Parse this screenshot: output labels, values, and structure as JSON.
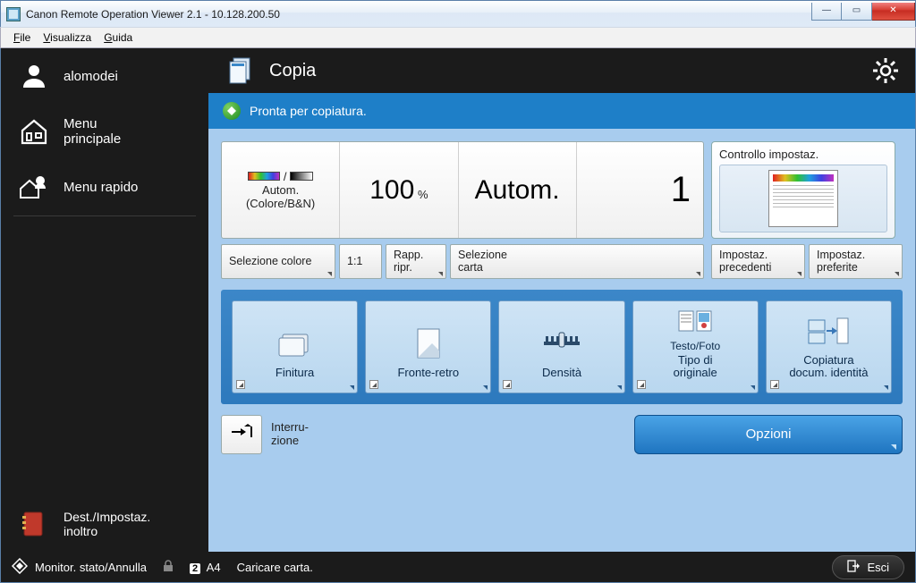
{
  "window": {
    "title": "Canon Remote Operation Viewer 2.1 - 10.128.200.50"
  },
  "menubar": {
    "file": "File",
    "view": "Visualizza",
    "help": "Guida"
  },
  "sidebar": {
    "user": "alomodei",
    "home_l1": "Menu",
    "home_l2": "principale",
    "quick": "Menu rapido",
    "forward_l1": "Dest./Impostaz.",
    "forward_l2": "inoltro"
  },
  "header": {
    "title": "Copia"
  },
  "status": {
    "text": "Pronta per copiatura."
  },
  "summary": {
    "color_l1": "Autom.",
    "color_l2": "(Colore/B&N)",
    "ratio_value": "100",
    "ratio_unit": "%",
    "paper": "Autom.",
    "copies": "1"
  },
  "controllo": {
    "label": "Controllo impostaz."
  },
  "buttons_row": {
    "select_color": "Selezione colore",
    "one_to_one": "1:1",
    "ratio_l1": "Rapp.",
    "ratio_l2": "ripr.",
    "paper_l1": "Selezione",
    "paper_l2": "carta",
    "prev_l1": "Impostaz.",
    "prev_l2": "precedenti",
    "fav_l1": "Impostaz.",
    "fav_l2": "preferite"
  },
  "tiles": {
    "finish": "Finitura",
    "duplex": "Fronte-retro",
    "density": "Densità",
    "orig_caption": "Testo/Foto",
    "orig_l1": "Tipo di",
    "orig_l2": "originale",
    "id_l1": "Copiatura",
    "id_l2": "docum. identità"
  },
  "bottom": {
    "interrupt_l1": "Interru-",
    "interrupt_l2": "zione",
    "options": "Opzioni"
  },
  "footer": {
    "monitor": "Monitor. stato/Annulla",
    "paper_num": "2",
    "paper_size": "A4",
    "load_paper": "Caricare carta.",
    "exit": "Esci"
  }
}
